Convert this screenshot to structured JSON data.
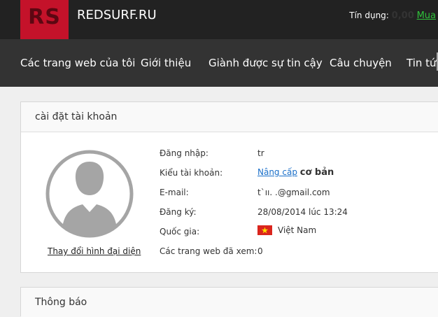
{
  "header": {
    "logo_text": "RS",
    "brand": "REDSURF.RU",
    "credit_label": "Tín dụng:",
    "credit_value": "0,00",
    "buy_label": "Mua"
  },
  "nav": {
    "items": [
      {
        "label": "Các trang web của tôi"
      },
      {
        "label": "Giới thiệu"
      },
      {
        "label": "Giành được sự tin cậy"
      },
      {
        "label": "Câu chuyện"
      },
      {
        "label": "Tin tức"
      }
    ]
  },
  "account": {
    "title": "cài đặt tài khoản",
    "change_avatar": "Thay đổi hình đại diện",
    "login_label": "Đăng nhập:",
    "login_value": "tr",
    "type_label": "Kiểu tài khoản:",
    "type_upgrade": "Nâng cấp",
    "type_value": "cơ bản",
    "email_label": "E-mail:",
    "email_value": "t`ıı.          .@gmail.com",
    "registered_label": "Đăng ký:",
    "registered_value": "28/08/2014 lúc 13:24",
    "country_label": "Quốc gia:",
    "country_value": "Việt Nam",
    "visited_label": "Các trang web đã xem:",
    "visited_value": "0"
  },
  "notifications": {
    "title": "Thông báo"
  },
  "colors": {
    "brand_red": "#c4122a",
    "topbar": "#222222",
    "navbar": "#333333",
    "link_blue": "#1a6fc9",
    "buy_green": "#2fc23a"
  }
}
